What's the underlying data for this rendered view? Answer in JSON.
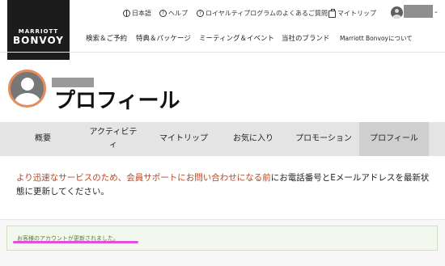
{
  "brand": {
    "line1": "MARRIOTT",
    "line2": "BONVOY"
  },
  "utility": {
    "language": "日本語",
    "help": "ヘルプ",
    "faq": "ロイヤルティプログラムのよくあるご質問",
    "my_trips": "マイトリップ"
  },
  "nav": {
    "items": [
      "検索＆ご予約",
      "特典＆パッケージ",
      "ミーティング＆イベント",
      "当社のブランド",
      "Marriott Bonvoyについて"
    ]
  },
  "profile": {
    "title": "プロフィール"
  },
  "tabs": [
    {
      "label": "概要"
    },
    {
      "label": "アクティビティ"
    },
    {
      "label": "マイトリップ"
    },
    {
      "label": "お気に入り"
    },
    {
      "label": "プロモーション"
    },
    {
      "label": "プロフィール",
      "active": true
    }
  ],
  "message": {
    "highlight": "より迅速なサービスのため、会員サポートにお問い合わせになる前",
    "rest": "にお電話番号とEメールアドレスを最新状態に更新してください。"
  },
  "success": {
    "text": "お客様のアカウントが更新されました。"
  },
  "colors": {
    "accent": "#e38d5f",
    "highlight_text": "#b8441c",
    "success_bg": "#f3f8ee",
    "annotation": "#e04fe0"
  }
}
